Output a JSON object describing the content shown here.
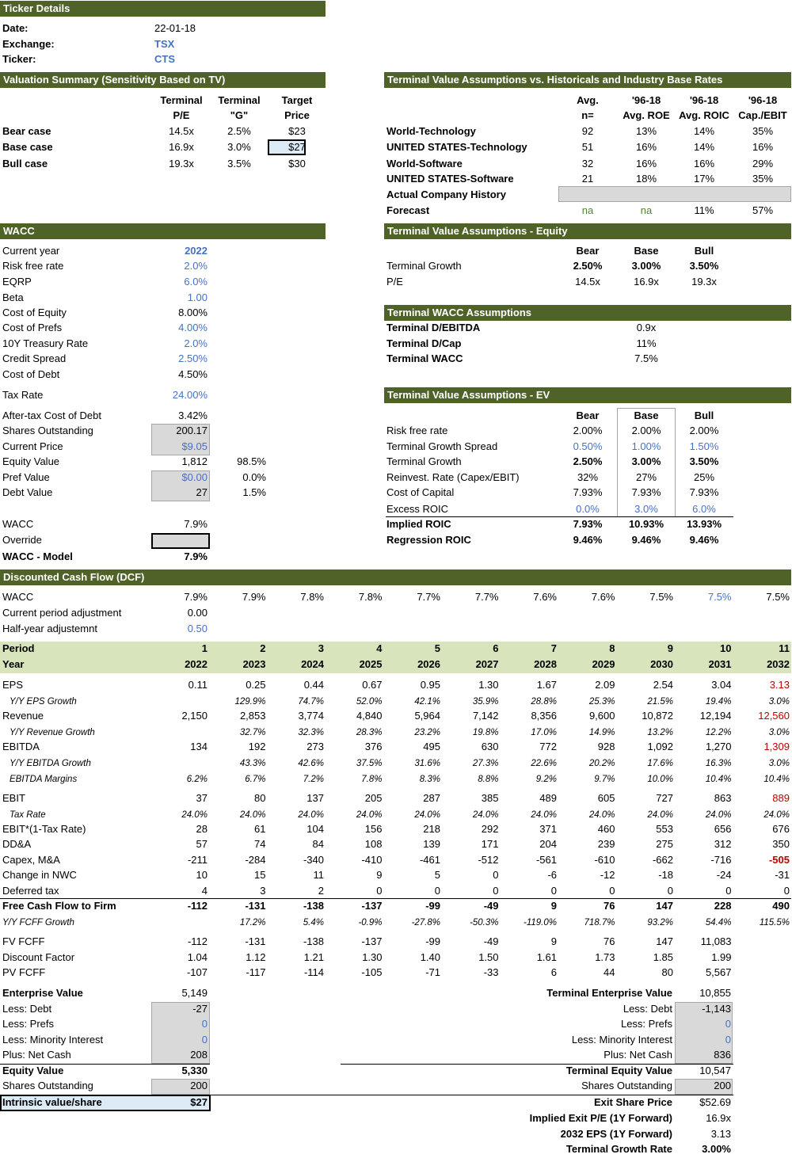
{
  "ticker": {
    "header": "Ticker Details",
    "rows": [
      {
        "label": "Date:",
        "value": "22-01-18"
      },
      {
        "label": "Exchange:",
        "value": "TSX"
      },
      {
        "label": "Ticker:",
        "value": "CTS"
      }
    ]
  },
  "valuation": {
    "header": "Valuation Summary (Sensitivity Based on TV)",
    "col_heads": [
      [
        "Terminal",
        "P/E"
      ],
      [
        "Terminal",
        "\"G\""
      ],
      [
        "Target",
        "Price"
      ]
    ],
    "rows": [
      {
        "label": "Bear case",
        "pe": "14.5x",
        "g": "2.5%",
        "price": "$23"
      },
      {
        "label": "Base case",
        "pe": "16.9x",
        "g": "3.0%",
        "price": "$27"
      },
      {
        "label": "Bull case",
        "pe": "19.3x",
        "g": "3.5%",
        "price": "$30"
      }
    ]
  },
  "tv_hist": {
    "header": "Terminal Value Assumptions vs. Historicals and Industry Base Rates",
    "col_heads": [
      [
        "Avg.",
        "n="
      ],
      [
        "'96-18",
        "Avg. ROE"
      ],
      [
        "'96-18",
        "Avg. ROIC"
      ],
      [
        "'96-18",
        "Cap./EBIT"
      ]
    ],
    "rows": [
      {
        "label": "World-Technology",
        "values": [
          "92",
          "13%",
          "14%",
          "35%"
        ]
      },
      {
        "label": "UNITED STATES-Technology",
        "values": [
          "51",
          "16%",
          "14%",
          "16%"
        ]
      },
      {
        "label": "World-Software",
        "values": [
          "32",
          "16%",
          "16%",
          "29%"
        ]
      },
      {
        "label": "UNITED STATES-Software",
        "values": [
          "21",
          "18%",
          "17%",
          "35%"
        ]
      },
      {
        "label": "Actual Company History",
        "values": [
          "",
          "",
          "",
          ""
        ]
      },
      {
        "label": "Forecast",
        "values": [
          "na",
          "na",
          "11%",
          "57%"
        ]
      }
    ]
  },
  "wacc": {
    "header": "WACC",
    "rows": [
      {
        "label": "Current year",
        "value": "2022"
      },
      {
        "label": "Risk free rate",
        "value": "2.0%"
      },
      {
        "label": "EQRP",
        "value": "6.0%"
      },
      {
        "label": "Beta",
        "value": "1.00"
      },
      {
        "label": "Cost of Equity",
        "value": "8.00%"
      },
      {
        "label": "Cost of Prefs",
        "value": "4.00%"
      },
      {
        "label": "10Y Treasury Rate",
        "value": "2.0%"
      },
      {
        "label": "Credit Spread",
        "value": "2.50%"
      },
      {
        "label": "Cost of Debt",
        "value": "4.50%"
      },
      {
        "label": "Tax Rate",
        "value": "24.00%"
      },
      {
        "label": "After-tax Cost of Debt",
        "value": "3.42%"
      },
      {
        "label": "Shares Outstanding",
        "value": "200.17"
      },
      {
        "label": "Current Price",
        "value": "$9.05"
      },
      {
        "label": "Equity Value",
        "value": "1,812",
        "pct": "98.5%"
      },
      {
        "label": "Pref Value",
        "value": "$0.00",
        "pct": "0.0%"
      },
      {
        "label": "Debt Value",
        "value": "27",
        "pct": "1.5%"
      },
      {
        "label": "WACC",
        "value": "7.9%"
      },
      {
        "label": "Override",
        "value": ""
      },
      {
        "label": "WACC - Model",
        "value": "7.9%"
      }
    ]
  },
  "tv_equity": {
    "header": "Terminal Value Assumptions - Equity",
    "col_heads": [
      "Bear",
      "Base",
      "Bull"
    ],
    "rows": [
      {
        "label": "Terminal Growth",
        "values": [
          "2.50%",
          "3.00%",
          "3.50%"
        ]
      },
      {
        "label": "P/E",
        "values": [
          "14.5x",
          "16.9x",
          "19.3x"
        ]
      }
    ]
  },
  "tv_wacc": {
    "header": "Terminal WACC Assumptions",
    "rows": [
      {
        "label": "Terminal D/EBITDA",
        "value": "0.9x"
      },
      {
        "label": "Terminal D/Cap",
        "value": "11%"
      },
      {
        "label": "Terminal WACC",
        "value": "7.5%"
      }
    ]
  },
  "tv_ev": {
    "header": "Terminal Value Assumptions - EV",
    "col_heads": [
      "Bear",
      "Base",
      "Bull"
    ],
    "rows": [
      {
        "label": "Risk free rate",
        "values": [
          "2.00%",
          "2.00%",
          "2.00%"
        ]
      },
      {
        "label": "Terminal Growth Spread",
        "values": [
          "0.50%",
          "1.00%",
          "1.50%"
        ]
      },
      {
        "label": "Terminal Growth",
        "values": [
          "2.50%",
          "3.00%",
          "3.50%"
        ]
      },
      {
        "label": "Reinvest. Rate (Capex/EBIT)",
        "values": [
          "32%",
          "27%",
          "25%"
        ]
      },
      {
        "label": "Cost of Capital",
        "values": [
          "7.93%",
          "7.93%",
          "7.93%"
        ]
      },
      {
        "label": "Excess ROIC",
        "values": [
          "0.0%",
          "3.0%",
          "6.0%"
        ]
      },
      {
        "label": "Implied ROIC",
        "values": [
          "7.93%",
          "10.93%",
          "13.93%"
        ]
      },
      {
        "label": "Regression ROIC",
        "values": [
          "9.46%",
          "9.46%",
          "9.46%"
        ]
      }
    ]
  },
  "dcf": {
    "header": "Discounted Cash Flow (DCF)",
    "wacc_row": {
      "label": "WACC",
      "values": [
        "7.9%",
        "7.9%",
        "7.8%",
        "7.8%",
        "7.7%",
        "7.7%",
        "7.6%",
        "7.6%",
        "7.5%",
        "7.5%",
        "7.5%"
      ]
    },
    "pre_rows": [
      {
        "label": "Current period adjustment",
        "value": "0.00"
      },
      {
        "label": "Half-year adjustemnt",
        "value": "0.50"
      }
    ],
    "period": {
      "label": "Period",
      "values": [
        "1",
        "2",
        "3",
        "4",
        "5",
        "6",
        "7",
        "8",
        "9",
        "10",
        "11"
      ]
    },
    "year": {
      "label": "Year",
      "values": [
        "2022",
        "2023",
        "2024",
        "2025",
        "2026",
        "2027",
        "2028",
        "2029",
        "2030",
        "2031",
        "2032"
      ]
    },
    "rows": [
      {
        "label": "EPS",
        "values": [
          "0.11",
          "0.25",
          "0.44",
          "0.67",
          "0.95",
          "1.30",
          "1.67",
          "2.09",
          "2.54",
          "3.04",
          "3.13"
        ]
      },
      {
        "label": "Y/Y EPS Growth",
        "values": [
          "",
          "129.9%",
          "74.7%",
          "52.0%",
          "42.1%",
          "35.9%",
          "28.8%",
          "25.3%",
          "21.5%",
          "19.4%",
          "3.0%"
        ]
      },
      {
        "label": "Revenue",
        "values": [
          "2,150",
          "2,853",
          "3,774",
          "4,840",
          "5,964",
          "7,142",
          "8,356",
          "9,600",
          "10,872",
          "12,194",
          "12,560"
        ]
      },
      {
        "label": "Y/Y Revenue Growth",
        "values": [
          "",
          "32.7%",
          "32.3%",
          "28.3%",
          "23.2%",
          "19.8%",
          "17.0%",
          "14.9%",
          "13.2%",
          "12.2%",
          "3.0%"
        ]
      },
      {
        "label": "EBITDA",
        "values": [
          "134",
          "192",
          "273",
          "376",
          "495",
          "630",
          "772",
          "928",
          "1,092",
          "1,270",
          "1,309"
        ]
      },
      {
        "label": "Y/Y EBITDA Growth",
        "values": [
          "",
          "43.3%",
          "42.6%",
          "37.5%",
          "31.6%",
          "27.3%",
          "22.6%",
          "20.2%",
          "17.6%",
          "16.3%",
          "3.0%"
        ]
      },
      {
        "label": "EBITDA Margins",
        "values": [
          "6.2%",
          "6.7%",
          "7.2%",
          "7.8%",
          "8.3%",
          "8.8%",
          "9.2%",
          "9.7%",
          "10.0%",
          "10.4%",
          "10.4%"
        ]
      },
      {
        "label": "EBIT",
        "values": [
          "37",
          "80",
          "137",
          "205",
          "287",
          "385",
          "489",
          "605",
          "727",
          "863",
          "889"
        ]
      },
      {
        "label": "Tax Rate",
        "values": [
          "24.0%",
          "24.0%",
          "24.0%",
          "24.0%",
          "24.0%",
          "24.0%",
          "24.0%",
          "24.0%",
          "24.0%",
          "24.0%",
          "24.0%"
        ]
      },
      {
        "label": "EBIT*(1-Tax Rate)",
        "values": [
          "28",
          "61",
          "104",
          "156",
          "218",
          "292",
          "371",
          "460",
          "553",
          "656",
          "676"
        ]
      },
      {
        "label": "DD&A",
        "values": [
          "57",
          "74",
          "84",
          "108",
          "139",
          "171",
          "204",
          "239",
          "275",
          "312",
          "350"
        ]
      },
      {
        "label": "Capex, M&A",
        "values": [
          "-211",
          "-284",
          "-340",
          "-410",
          "-461",
          "-512",
          "-561",
          "-610",
          "-662",
          "-716",
          "-505"
        ]
      },
      {
        "label": "Change in NWC",
        "values": [
          "10",
          "15",
          "11",
          "9",
          "5",
          "0",
          "-6",
          "-12",
          "-18",
          "-24",
          "-31"
        ]
      },
      {
        "label": "Deferred tax",
        "values": [
          "4",
          "3",
          "2",
          "0",
          "0",
          "0",
          "0",
          "0",
          "0",
          "0",
          "0"
        ]
      },
      {
        "label": "Free Cash Flow to Firm",
        "values": [
          "-112",
          "-131",
          "-138",
          "-137",
          "-99",
          "-49",
          "9",
          "76",
          "147",
          "228",
          "490"
        ]
      },
      {
        "label": "Y/Y FCFF Growth",
        "values": [
          "",
          "17.2%",
          "5.4%",
          "-0.9%",
          "-27.8%",
          "-50.3%",
          "-119.0%",
          "718.7%",
          "93.2%",
          "54.4%",
          "115.5%"
        ]
      },
      {
        "label": "FV FCFF",
        "values": [
          "-112",
          "-131",
          "-138",
          "-137",
          "-99",
          "-49",
          "9",
          "76",
          "147",
          "11,083",
          ""
        ]
      },
      {
        "label": "Discount Factor",
        "values": [
          "1.04",
          "1.12",
          "1.21",
          "1.30",
          "1.40",
          "1.50",
          "1.61",
          "1.73",
          "1.85",
          "1.99",
          ""
        ]
      },
      {
        "label": "PV FCFF",
        "values": [
          "-107",
          "-117",
          "-114",
          "-105",
          "-71",
          "-33",
          "6",
          "44",
          "80",
          "5,567",
          ""
        ]
      }
    ]
  },
  "ev_bridge": [
    {
      "label": "Enterprise Value",
      "value": "5,149"
    },
    {
      "label": "Less: Debt",
      "value": "-27"
    },
    {
      "label": "Less: Prefs",
      "value": "0"
    },
    {
      "label": "Less: Minority Interest",
      "value": "0"
    },
    {
      "label": "Plus: Net Cash",
      "value": "208"
    },
    {
      "label": "Equity Value",
      "value": "5,330"
    },
    {
      "label": "Shares Outstanding",
      "value": "200"
    },
    {
      "label": "Intrinsic value/share",
      "value": "$27"
    }
  ],
  "terminal_bridge": [
    {
      "label": "Terminal Enterprise Value",
      "value": "10,855"
    },
    {
      "label": "Less: Debt",
      "value": "-1,143"
    },
    {
      "label": "Less: Prefs",
      "value": "0"
    },
    {
      "label": "Less: Minority Interest",
      "value": "0"
    },
    {
      "label": "Plus: Net Cash",
      "value": "836"
    },
    {
      "label": "Terminal Equity Value",
      "value": "10,547"
    },
    {
      "label": "Shares Outstanding",
      "value": "200"
    },
    {
      "label": "Exit Share Price",
      "value": "$52.69"
    },
    {
      "label": "Implied Exit P/E (1Y Forward)",
      "value": "16.9x"
    },
    {
      "label": "2032 EPS (1Y Forward)",
      "value": "3.13"
    },
    {
      "label": "Terminal Growth Rate",
      "value": "3.00%"
    }
  ],
  "colors": {
    "header_bg": "#4f6228",
    "band_bg": "#d8e4bc",
    "input_blue": "#4472c4",
    "terminal_red": "#c00000"
  }
}
